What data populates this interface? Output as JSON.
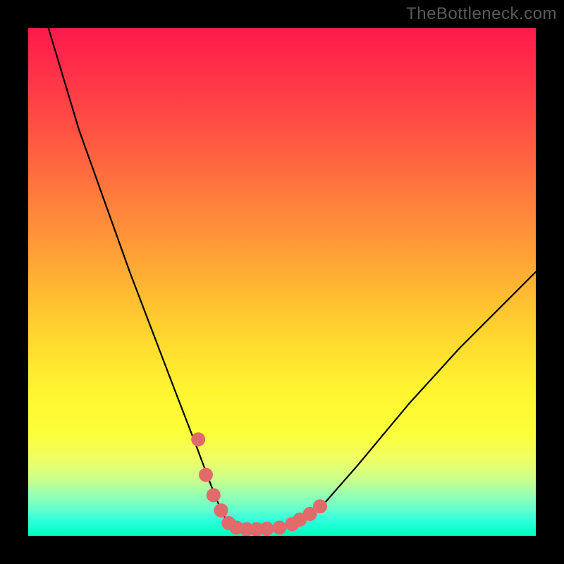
{
  "watermark": "TheBottleneck.com",
  "chart_data": {
    "type": "line",
    "title": "",
    "xlabel": "",
    "ylabel": "",
    "xlim": [
      0,
      100
    ],
    "ylim": [
      0,
      100
    ],
    "series": [
      {
        "name": "curve",
        "x": [
          4,
          10,
          20,
          28,
          33,
          36,
          38,
          39.5,
          41,
          43,
          46,
          50,
          53,
          58,
          65,
          75,
          85,
          95,
          100
        ],
        "y": [
          100,
          80,
          52,
          31,
          18,
          10,
          5,
          2.3,
          1.5,
          1.3,
          1.3,
          1.5,
          2.5,
          6,
          14,
          26,
          37,
          47,
          52
        ]
      }
    ],
    "highlight_points": {
      "name": "highlight",
      "x": [
        33.5,
        35,
        36.5,
        38,
        39.5,
        41,
        43,
        45,
        47,
        49.5,
        52,
        53.5,
        55.5,
        57.5
      ],
      "y": [
        19,
        12,
        8,
        5,
        2.5,
        1.6,
        1.3,
        1.3,
        1.4,
        1.6,
        2.3,
        3.2,
        4.3,
        5.8
      ]
    },
    "colors": {
      "curve_stroke": "#000000",
      "highlight_fill": "#e26a6a"
    }
  }
}
